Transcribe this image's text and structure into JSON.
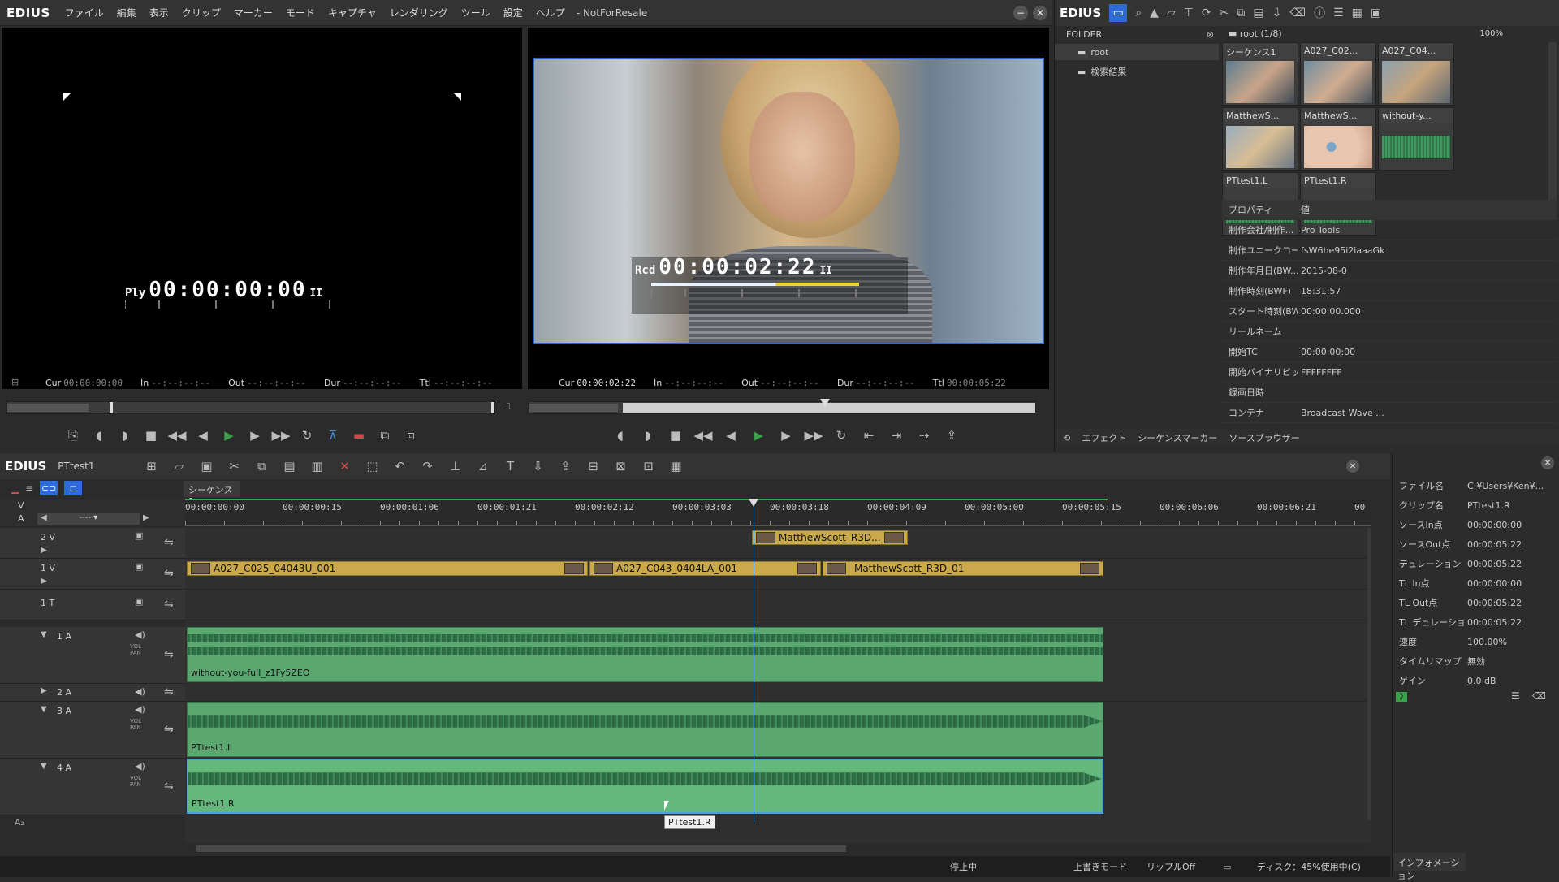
{
  "app": {
    "logo": "EDIUS",
    "menu": [
      "ファイル",
      "編集",
      "表示",
      "クリップ",
      "マーカー",
      "モード",
      "キャプチャ",
      "レンダリング",
      "ツール",
      "設定",
      "ヘルプ"
    ],
    "title": "- NotForResale"
  },
  "player": {
    "mode": "Ply",
    "timecode": "00:00:00:00",
    "pause": "II",
    "info": [
      {
        "label": "Cur",
        "value": "00:00:00:00"
      },
      {
        "label": "In",
        "value": "--:--:--:--"
      },
      {
        "label": "Out",
        "value": "--:--:--:--"
      },
      {
        "label": "Dur",
        "value": "--:--:--:--"
      },
      {
        "label": "Ttl",
        "value": "--:--:--:--"
      }
    ]
  },
  "recorder": {
    "mode": "Rcd",
    "timecode": "00:00:02:22",
    "pause": "II",
    "info": [
      {
        "label": "Cur",
        "value": "00:00:02:22"
      },
      {
        "label": "In",
        "value": "--:--:--:--"
      },
      {
        "label": "Out",
        "value": "--:--:--:--"
      },
      {
        "label": "Dur",
        "value": "--:--:--:--"
      },
      {
        "label": "Ttl",
        "value": "00:00:05:22"
      }
    ],
    "playhead_fraction": 0.49
  },
  "bin": {
    "logo": "EDIUS",
    "folder_header": "FOLDER",
    "folders": [
      "root",
      "検索結果"
    ],
    "path": "root (1/8)",
    "zoom": "100%",
    "clips": [
      {
        "name": "シーケンス1",
        "kind": "video"
      },
      {
        "name": "A027_C02...",
        "kind": "video"
      },
      {
        "name": "A027_C04...",
        "kind": "video"
      },
      {
        "name": "MatthewS...",
        "kind": "video"
      },
      {
        "name": "MatthewS...",
        "kind": "video"
      },
      {
        "name": "without-y...",
        "kind": "audio"
      },
      {
        "name": "PTtest1.L",
        "kind": "audio"
      },
      {
        "name": "PTtest1.R",
        "kind": "audio"
      }
    ],
    "props_header": {
      "key": "プロパティ",
      "val": "値"
    },
    "props": [
      {
        "k": "制作会社/制作...",
        "v": "Pro Tools"
      },
      {
        "k": "制作ユニークコー...",
        "v": "fsW6he95i2iaaaGk"
      },
      {
        "k": "制作年月日(BW...",
        "v": "2015-08-0"
      },
      {
        "k": "制作時刻(BWF)",
        "v": "18:31:57"
      },
      {
        "k": "スタート時刻(BW...",
        "v": "00:00:00.000"
      },
      {
        "k": "リールネーム",
        "v": ""
      },
      {
        "k": "開始TC",
        "v": "00:00:00:00"
      },
      {
        "k": "開始バイナリビット...",
        "v": "FFFFFFFF"
      },
      {
        "k": "録画日時",
        "v": ""
      },
      {
        "k": "コンテナ",
        "v": "Broadcast Wave ..."
      }
    ],
    "tabs": [
      "エフェクト",
      "シーケンスマーカー",
      "ソースブラウザー"
    ]
  },
  "timeline": {
    "logo": "EDIUS",
    "project": "PTtest1",
    "sequence_tab": "シーケンス1",
    "ruler": [
      "00:00:00:00",
      "00:00:00:15",
      "00:00:01:06",
      "00:00:01:21",
      "00:00:02:12",
      "00:00:03:03",
      "00:00:03:18",
      "00:00:04:09",
      "00:00:05:00",
      "00:00:05:15",
      "00:00:06:06",
      "00:00:06:21",
      "00"
    ],
    "playhead_seconds": 2.92,
    "tracks": [
      {
        "id": "2 V",
        "type": "V"
      },
      {
        "id": "1 V",
        "type": "V"
      },
      {
        "id": "1 T",
        "type": "T"
      },
      {
        "id": "1 A",
        "type": "A"
      },
      {
        "id": "2 A",
        "type": "A"
      },
      {
        "id": "3 A",
        "type": "A"
      },
      {
        "id": "4 A",
        "type": "A"
      }
    ],
    "clips": {
      "v2": "MatthewScott_R3D...",
      "v1": [
        "A027_C025_04043U_001",
        "A027_C043_0404LA_001",
        "MatthewScott_R3D_01"
      ],
      "a1": "without-you-full_z1Fy5ZEO",
      "a3": "PTtest1.L",
      "a4": "PTtest1.R"
    },
    "tooltip": "PTtest1.R",
    "volpan": "VOL\nPAN"
  },
  "inspector": {
    "rows": [
      {
        "k": "ファイル名",
        "v": "C:¥Users¥Ken¥..."
      },
      {
        "k": "クリップ名",
        "v": "PTtest1.R"
      },
      {
        "k": "ソースIn点",
        "v": "00:00:00:00"
      },
      {
        "k": "ソースOut点",
        "v": "00:00:05:22"
      },
      {
        "k": "デュレーション",
        "v": "00:00:05:22"
      },
      {
        "k": "TL In点",
        "v": "00:00:00:00"
      },
      {
        "k": "TL Out点",
        "v": "00:00:05:22"
      },
      {
        "k": "TL デュレーション",
        "v": "00:00:05:22"
      },
      {
        "k": "速度",
        "v": "100.00%"
      },
      {
        "k": "タイムリマップ",
        "v": "無効"
      },
      {
        "k": "ゲイン",
        "v": "0.0 dB"
      }
    ],
    "tab": "インフォメーション"
  },
  "status": {
    "state": "停止中",
    "mode": "上書きモード",
    "ripple": "リップルOff",
    "disk": "ディスク：45%使用中(C)"
  }
}
